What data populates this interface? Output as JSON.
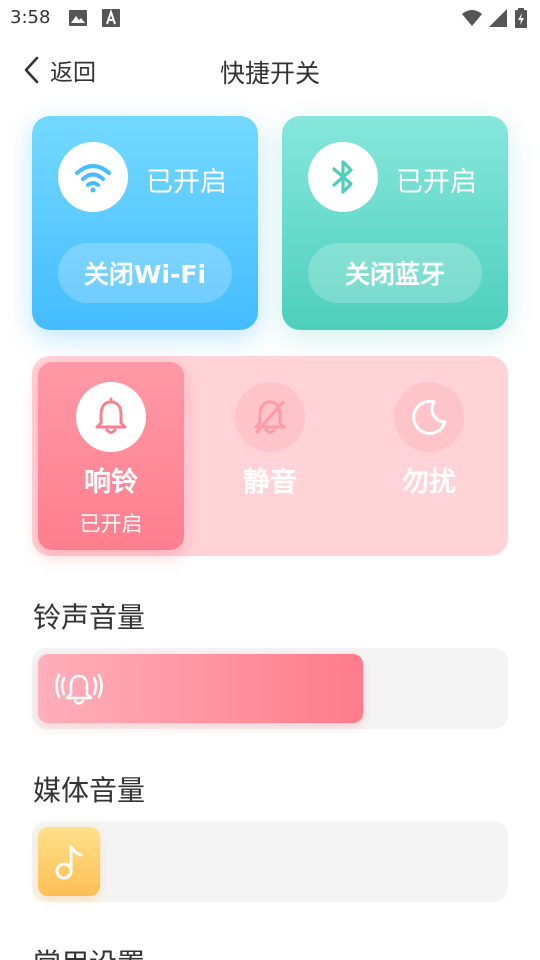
{
  "status_bar": {
    "time": "3:58",
    "icons": [
      "image-icon",
      "a-notification-icon",
      "wifi-signal-icon",
      "cell-signal-icon",
      "battery-icon"
    ]
  },
  "header": {
    "back_label": "返回",
    "title": "快捷开关"
  },
  "wifi_card": {
    "icon": "wifi-icon",
    "status": "已开启",
    "action": "关闭Wi-Fi",
    "color_top": "#74d9ff",
    "color_bottom": "#44bcff"
  },
  "bluetooth_card": {
    "icon": "bluetooth-icon",
    "status": "已开启",
    "action": "关闭蓝牙",
    "color_top": "#86e7dc",
    "color_bottom": "#4ecfbc"
  },
  "ring_modes": {
    "options": [
      {
        "icon": "bell-icon",
        "label": "响铃",
        "sub": "已开启",
        "active": true
      },
      {
        "icon": "bell-off-icon",
        "label": "静音",
        "sub": "",
        "active": false
      },
      {
        "icon": "moon-icon",
        "label": "勿扰",
        "sub": "",
        "active": false
      }
    ],
    "accent": "#ff7e8e"
  },
  "ringtone_volume": {
    "title": "铃声音量",
    "icon": "ringing-bell-icon",
    "level": 0.7
  },
  "media_volume": {
    "title": "媒体音量",
    "icon": "music-note-icon",
    "level": 0.13
  },
  "common_settings": {
    "title": "常用设置"
  }
}
